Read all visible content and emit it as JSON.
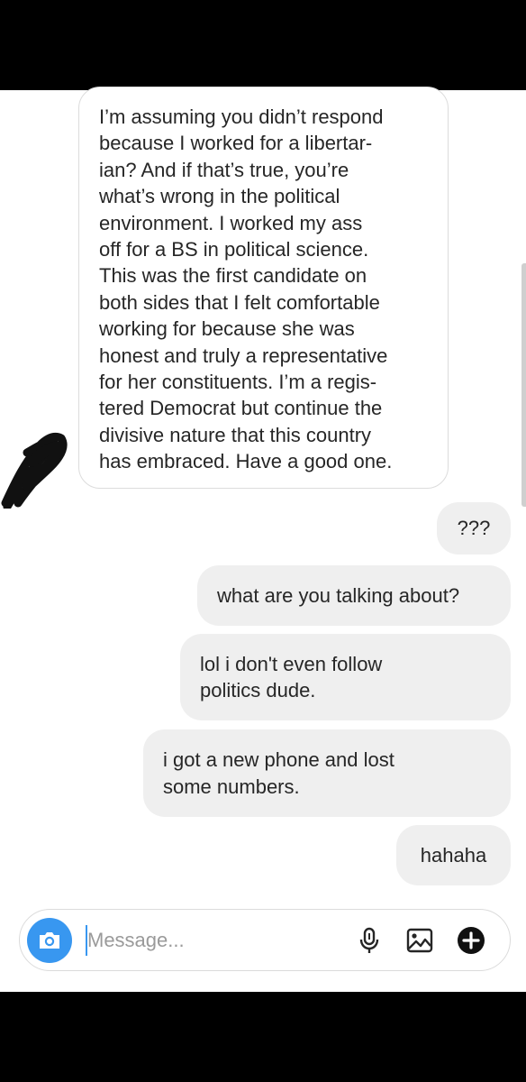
{
  "conversation": {
    "incoming_message": "I’m assuming you didn’t respond\nbecause I worked for a libertar-\nian? And if that’s true,  you’re\nwhat’s wrong in the political\nenvironment. I worked my ass\noff for a BS in political science.\nThis was the first candidate on\nboth sides that I felt comfortable\nworking for because she was\nhonest and truly a representative\nfor her constituents. I’m a regis-\ntered Democrat but continue the\ndivisive nature that this country\nhas embraced. Have a good one.",
    "outgoing_messages": [
      "???",
      "what are you talking about?",
      "lol i don't even follow\npolitics dude.",
      "i got a new phone and lost\nsome numbers.",
      "hahaha"
    ]
  },
  "composer": {
    "placeholder": "Message...",
    "icons": [
      "camera-icon",
      "microphone-icon",
      "gallery-icon",
      "plus-icon"
    ],
    "accent_color": "#3897f0"
  },
  "colors": {
    "outgoing_bubble": "#efefef",
    "incoming_border": "#dcdcdc",
    "system_bars": "#000000"
  }
}
